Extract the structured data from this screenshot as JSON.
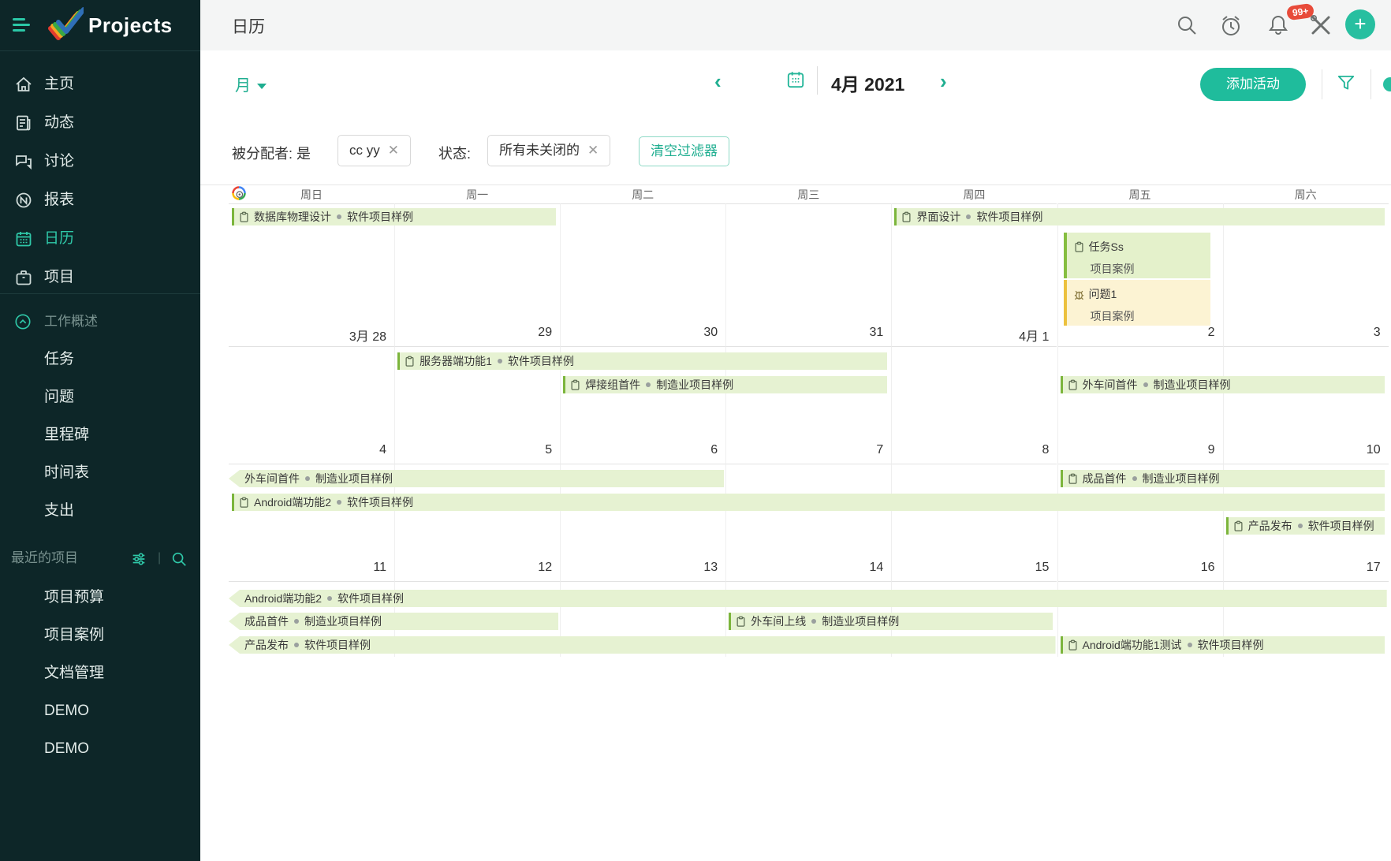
{
  "sidebar": {
    "logo": "Projects",
    "items": [
      {
        "label": "主页"
      },
      {
        "label": "动态"
      },
      {
        "label": "讨论"
      },
      {
        "label": "报表"
      },
      {
        "label": "日历",
        "selected": true
      },
      {
        "label": "项目"
      }
    ],
    "work_overview": {
      "label": "工作概述",
      "items": [
        "任务",
        "问题",
        "里程碑",
        "时间表",
        "支出"
      ]
    },
    "recent": {
      "label": "最近的项目",
      "items": [
        "项目预算",
        "项目案例",
        "文档管理",
        "DEMO",
        "DEMO"
      ]
    }
  },
  "topbar": {
    "title": "日历",
    "notification_badge": "99+",
    "plus_label": "+"
  },
  "toolbar": {
    "view_selector": "月",
    "month_label": "4月 2021",
    "prev": "‹",
    "next": "›",
    "add_button": "添加活动"
  },
  "filters": {
    "assignee_label": "被分配者: 是",
    "assignee_chip": "cc yy",
    "status_label": "状态:",
    "status_chip": "所有未关闭的",
    "clear_button": "清空过滤器",
    "close_glyph": "✕"
  },
  "colors": {
    "accent_teal": "#1fbc9c",
    "sidebar_bg": "#0d2628",
    "event_green_bg": "#e6f2d2",
    "event_green_border": "#7cb53c",
    "issue_yellow_bg": "#fcf3d3",
    "issue_yellow_border": "#ecc13e",
    "badge_red": "#e84b3a"
  },
  "calendar": {
    "weekdays": [
      "周日",
      "周一",
      "周二",
      "周三",
      "周四",
      "周五",
      "周六"
    ],
    "weeks": [
      {
        "dates": [
          "3月 28",
          "29",
          "30",
          "31",
          "4月 1",
          "2",
          "3"
        ],
        "events": [
          {
            "title": "数据库物理设计",
            "project": "软件项目样例",
            "col": 0,
            "span": 2,
            "slot": 0,
            "kind": "task",
            "icon": true
          },
          {
            "title": "界面设计",
            "project": "软件项目样例",
            "col": 4,
            "span": 3,
            "slot": 0,
            "kind": "task",
            "icon": true
          },
          {
            "type": "box",
            "title": "任务Ss",
            "project": "项目案例",
            "col": 5,
            "slot": 1,
            "kind": "task",
            "icon": true
          },
          {
            "type": "box",
            "title": "问题1",
            "project": "项目案例",
            "col": 5,
            "slot": 2,
            "kind": "issue",
            "icon": true
          }
        ]
      },
      {
        "dates": [
          "4",
          "5",
          "6",
          "7",
          "8",
          "9",
          "10"
        ],
        "events": [
          {
            "title": "服务器端功能1",
            "project": "软件项目样例",
            "col": 1,
            "span": 3,
            "slot": 0,
            "kind": "task",
            "icon": true
          },
          {
            "title": "焊接组首件",
            "project": "制造业项目样例",
            "col": 2,
            "span": 2,
            "slot": 1,
            "kind": "task",
            "icon": true
          },
          {
            "title": "外车间首件",
            "project": "制造业项目样例",
            "col": 5,
            "span": 2,
            "slot": 1,
            "kind": "task",
            "icon": true
          }
        ]
      },
      {
        "dates": [
          "11",
          "12",
          "13",
          "14",
          "15",
          "16",
          "17"
        ],
        "events": [
          {
            "title": "外车间首件",
            "project": "制造业项目样例",
            "col": 0,
            "span": 3,
            "slot": 0,
            "kind": "task",
            "continuation": true
          },
          {
            "title": "成品首件",
            "project": "制造业项目样例",
            "col": 5,
            "span": 2,
            "slot": 0,
            "kind": "task",
            "icon": true
          },
          {
            "title": "Android端功能2",
            "project": "软件项目样例",
            "col": 0,
            "span": 7,
            "slot": 1,
            "kind": "task",
            "icon": true
          },
          {
            "title": "产品发布",
            "project": "软件项目样例",
            "col": 6,
            "span": 1,
            "slot": 2,
            "kind": "task",
            "icon": true
          }
        ]
      },
      {
        "dates": [],
        "events": [
          {
            "title": "Android端功能2",
            "project": "软件项目样例",
            "col": 0,
            "span": 7,
            "slot": 0,
            "kind": "task",
            "continuation": true
          },
          {
            "title": "成品首件",
            "project": "制造业项目样例",
            "col": 0,
            "span": 2,
            "slot": 1,
            "kind": "task",
            "continuation": true
          },
          {
            "title": "外车间上线",
            "project": "制造业项目样例",
            "col": 3,
            "span": 2,
            "slot": 1,
            "kind": "task",
            "icon": true
          },
          {
            "title": "产品发布",
            "project": "软件项目样例",
            "col": 0,
            "span": 5,
            "slot": 2,
            "kind": "task",
            "continuation": true
          },
          {
            "title": "Android端功能1测试",
            "project": "软件项目样例",
            "col": 5,
            "span": 2,
            "slot": 2,
            "kind": "task",
            "icon": true
          }
        ]
      }
    ]
  }
}
